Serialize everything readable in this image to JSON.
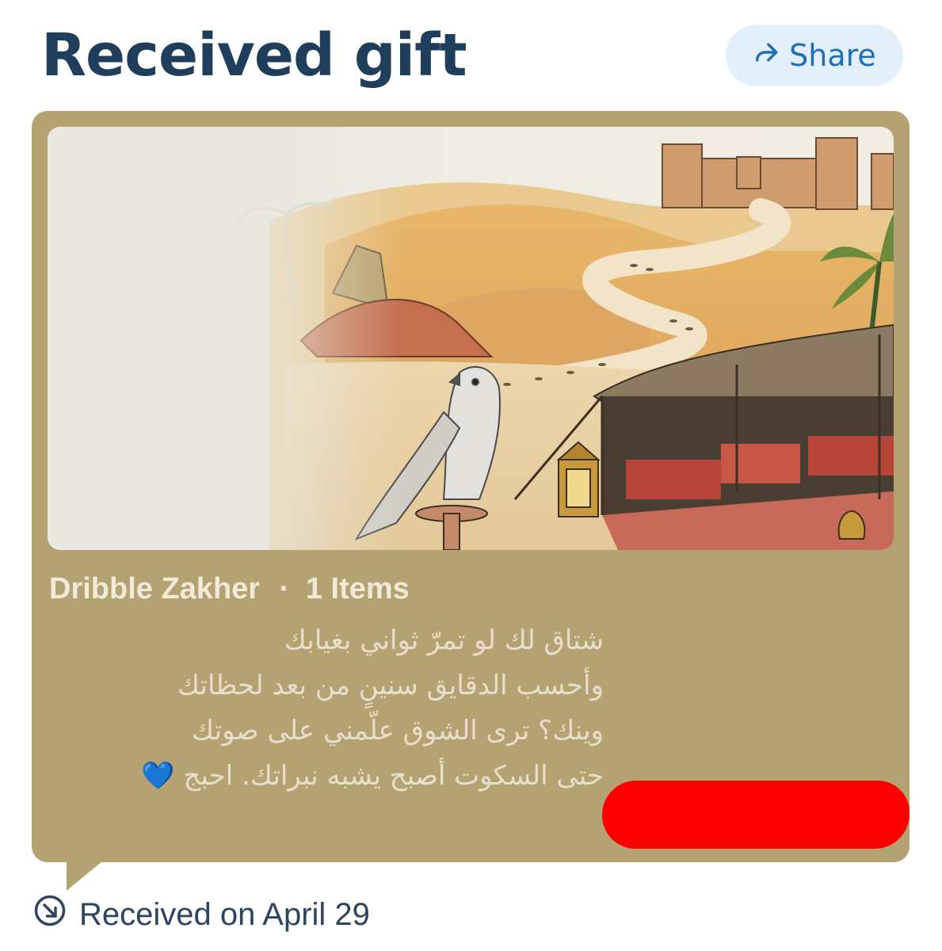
{
  "header": {
    "title": "Received gift",
    "share_label": "Share"
  },
  "gift": {
    "sender": "Dribble Zakher",
    "separator": "·",
    "items_count": "1 Items",
    "message_lines": [
      "شتاق لك لو تمرّ ثواني بغيابك",
      "وأحسب الدقايق سنينٍ من بعد لحظاتك",
      "وينك؟ ترى الشوق علّمني على صوتك",
      "حتى السكوت أصبح يشبه نبراتك.  احبج 💙"
    ],
    "card_color": "#b4a273"
  },
  "footer": {
    "received_text": "Received on April 29"
  },
  "icons": {
    "share": "share-arrow-icon",
    "received": "received-arrow-icon"
  },
  "colors": {
    "title": "#1f3e5c",
    "share_bg": "#e3f0fb",
    "share_text": "#1f6fb8",
    "redaction": "#fe0000"
  }
}
